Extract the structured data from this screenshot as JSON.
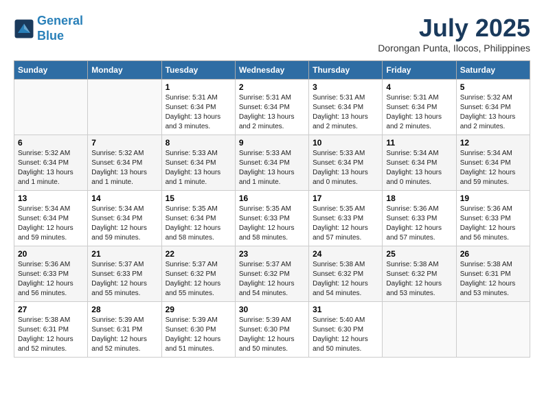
{
  "header": {
    "logo_line1": "General",
    "logo_line2": "Blue",
    "month_title": "July 2025",
    "location": "Dorongan Punta, Ilocos, Philippines"
  },
  "days_of_week": [
    "Sunday",
    "Monday",
    "Tuesday",
    "Wednesday",
    "Thursday",
    "Friday",
    "Saturday"
  ],
  "weeks": [
    [
      {
        "day": "",
        "info": ""
      },
      {
        "day": "",
        "info": ""
      },
      {
        "day": "1",
        "info": "Sunrise: 5:31 AM\nSunset: 6:34 PM\nDaylight: 13 hours and 3 minutes."
      },
      {
        "day": "2",
        "info": "Sunrise: 5:31 AM\nSunset: 6:34 PM\nDaylight: 13 hours and 2 minutes."
      },
      {
        "day": "3",
        "info": "Sunrise: 5:31 AM\nSunset: 6:34 PM\nDaylight: 13 hours and 2 minutes."
      },
      {
        "day": "4",
        "info": "Sunrise: 5:31 AM\nSunset: 6:34 PM\nDaylight: 13 hours and 2 minutes."
      },
      {
        "day": "5",
        "info": "Sunrise: 5:32 AM\nSunset: 6:34 PM\nDaylight: 13 hours and 2 minutes."
      }
    ],
    [
      {
        "day": "6",
        "info": "Sunrise: 5:32 AM\nSunset: 6:34 PM\nDaylight: 13 hours and 1 minute."
      },
      {
        "day": "7",
        "info": "Sunrise: 5:32 AM\nSunset: 6:34 PM\nDaylight: 13 hours and 1 minute."
      },
      {
        "day": "8",
        "info": "Sunrise: 5:33 AM\nSunset: 6:34 PM\nDaylight: 13 hours and 1 minute."
      },
      {
        "day": "9",
        "info": "Sunrise: 5:33 AM\nSunset: 6:34 PM\nDaylight: 13 hours and 1 minute."
      },
      {
        "day": "10",
        "info": "Sunrise: 5:33 AM\nSunset: 6:34 PM\nDaylight: 13 hours and 0 minutes."
      },
      {
        "day": "11",
        "info": "Sunrise: 5:34 AM\nSunset: 6:34 PM\nDaylight: 13 hours and 0 minutes."
      },
      {
        "day": "12",
        "info": "Sunrise: 5:34 AM\nSunset: 6:34 PM\nDaylight: 12 hours and 59 minutes."
      }
    ],
    [
      {
        "day": "13",
        "info": "Sunrise: 5:34 AM\nSunset: 6:34 PM\nDaylight: 12 hours and 59 minutes."
      },
      {
        "day": "14",
        "info": "Sunrise: 5:34 AM\nSunset: 6:34 PM\nDaylight: 12 hours and 59 minutes."
      },
      {
        "day": "15",
        "info": "Sunrise: 5:35 AM\nSunset: 6:34 PM\nDaylight: 12 hours and 58 minutes."
      },
      {
        "day": "16",
        "info": "Sunrise: 5:35 AM\nSunset: 6:33 PM\nDaylight: 12 hours and 58 minutes."
      },
      {
        "day": "17",
        "info": "Sunrise: 5:35 AM\nSunset: 6:33 PM\nDaylight: 12 hours and 57 minutes."
      },
      {
        "day": "18",
        "info": "Sunrise: 5:36 AM\nSunset: 6:33 PM\nDaylight: 12 hours and 57 minutes."
      },
      {
        "day": "19",
        "info": "Sunrise: 5:36 AM\nSunset: 6:33 PM\nDaylight: 12 hours and 56 minutes."
      }
    ],
    [
      {
        "day": "20",
        "info": "Sunrise: 5:36 AM\nSunset: 6:33 PM\nDaylight: 12 hours and 56 minutes."
      },
      {
        "day": "21",
        "info": "Sunrise: 5:37 AM\nSunset: 6:33 PM\nDaylight: 12 hours and 55 minutes."
      },
      {
        "day": "22",
        "info": "Sunrise: 5:37 AM\nSunset: 6:32 PM\nDaylight: 12 hours and 55 minutes."
      },
      {
        "day": "23",
        "info": "Sunrise: 5:37 AM\nSunset: 6:32 PM\nDaylight: 12 hours and 54 minutes."
      },
      {
        "day": "24",
        "info": "Sunrise: 5:38 AM\nSunset: 6:32 PM\nDaylight: 12 hours and 54 minutes."
      },
      {
        "day": "25",
        "info": "Sunrise: 5:38 AM\nSunset: 6:32 PM\nDaylight: 12 hours and 53 minutes."
      },
      {
        "day": "26",
        "info": "Sunrise: 5:38 AM\nSunset: 6:31 PM\nDaylight: 12 hours and 53 minutes."
      }
    ],
    [
      {
        "day": "27",
        "info": "Sunrise: 5:38 AM\nSunset: 6:31 PM\nDaylight: 12 hours and 52 minutes."
      },
      {
        "day": "28",
        "info": "Sunrise: 5:39 AM\nSunset: 6:31 PM\nDaylight: 12 hours and 52 minutes."
      },
      {
        "day": "29",
        "info": "Sunrise: 5:39 AM\nSunset: 6:30 PM\nDaylight: 12 hours and 51 minutes."
      },
      {
        "day": "30",
        "info": "Sunrise: 5:39 AM\nSunset: 6:30 PM\nDaylight: 12 hours and 50 minutes."
      },
      {
        "day": "31",
        "info": "Sunrise: 5:40 AM\nSunset: 6:30 PM\nDaylight: 12 hours and 50 minutes."
      },
      {
        "day": "",
        "info": ""
      },
      {
        "day": "",
        "info": ""
      }
    ]
  ]
}
